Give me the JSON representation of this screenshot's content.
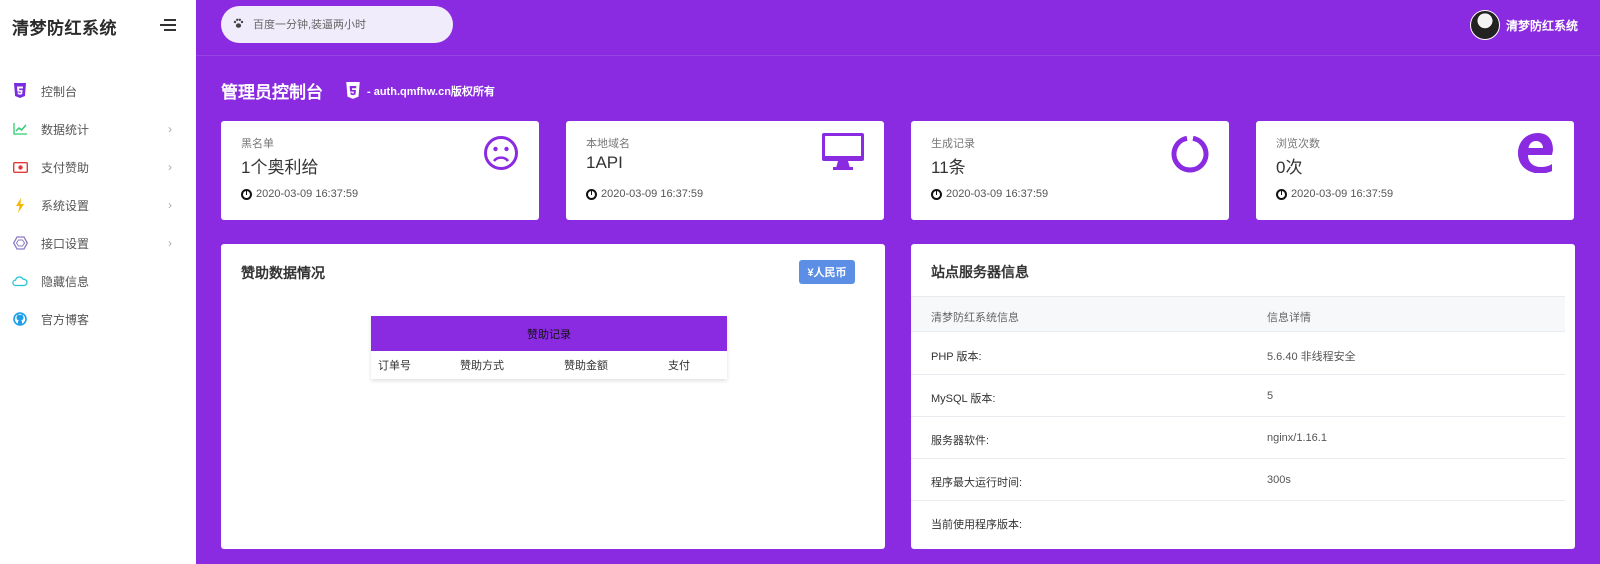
{
  "app": {
    "brand": "清梦防红系统"
  },
  "sidebar": {
    "items": [
      {
        "label": "控制台",
        "icon": "html5-icon",
        "color": "#7b2be0",
        "has_arrow": false
      },
      {
        "label": "数据统计",
        "icon": "line-chart-icon",
        "color": "#2ecc71",
        "has_arrow": true
      },
      {
        "label": "支付赞助",
        "icon": "money-icon",
        "color": "#e53935",
        "has_arrow": true
      },
      {
        "label": "系统设置",
        "icon": "bolt-icon",
        "color": "#f5b700",
        "has_arrow": true
      },
      {
        "label": "接口设置",
        "icon": "hexagon-icon",
        "color": "#8e7cc3",
        "has_arrow": true
      },
      {
        "label": "隐藏信息",
        "icon": "cloud-icon",
        "color": "#20c4d8",
        "has_arrow": false
      },
      {
        "label": "官方博客",
        "icon": "github-icon",
        "color": "#1e9fe8",
        "has_arrow": false
      }
    ]
  },
  "topbar": {
    "search_placeholder": "百度一分钟,装逼两小时",
    "user_name": "清梦防红系统"
  },
  "page": {
    "title": "管理员控制台",
    "subtitle": "- auth.qmfhw.cn版权所有"
  },
  "stats": [
    {
      "label": "黑名单",
      "value": "1个奥利给",
      "time": "2020-03-09 16:37:59",
      "icon": "frown-icon"
    },
    {
      "label": "本地域名",
      "value": "1API",
      "time": "2020-03-09 16:37:59",
      "icon": "monitor-icon"
    },
    {
      "label": "生成记录",
      "value": "11条",
      "time": "2020-03-09 16:37:59",
      "icon": "circle-notch-icon"
    },
    {
      "label": "浏览次数",
      "value": "0次",
      "time": "2020-03-09 16:37:59",
      "icon": "edge-icon"
    }
  ],
  "donation": {
    "title": "赞助数据情况",
    "currency_button": "¥人民币",
    "table_title": "赞助记录",
    "columns": [
      "订单号",
      "赞助方式",
      "赞助金额",
      "支付"
    ]
  },
  "server": {
    "title": "站点服务器信息",
    "header": [
      "清梦防红系统信息",
      "信息详情"
    ],
    "rows": [
      {
        "key": "PHP 版本:",
        "value": "5.6.40 非线程安全"
      },
      {
        "key": "MySQL 版本:",
        "value": "5"
      },
      {
        "key": "服务器软件:",
        "value": "nginx/1.16.1"
      },
      {
        "key": "程序最大运行时间:",
        "value": "300s"
      },
      {
        "key": "当前使用程序版本:",
        "value": ""
      }
    ]
  },
  "colors": {
    "accent": "#8a2be2",
    "button": "#5c8ee6"
  }
}
